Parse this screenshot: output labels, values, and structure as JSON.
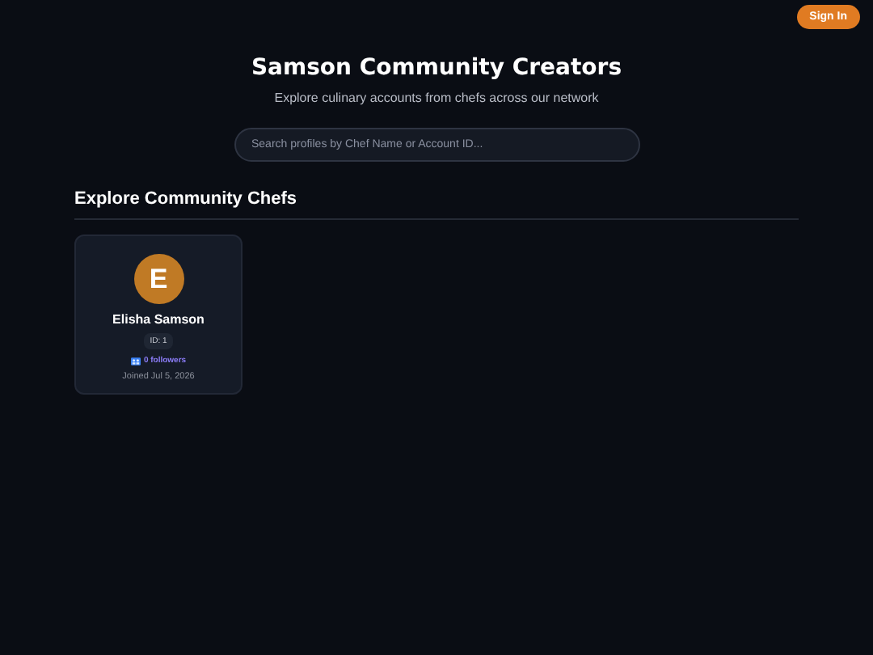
{
  "header": {
    "sign_in": "Sign In"
  },
  "hero": {
    "title": "Samson Community Creators",
    "subtitle": "Explore culinary accounts from chefs across our network"
  },
  "search": {
    "placeholder": "Search profiles by Chef Name or Account ID..."
  },
  "section": {
    "title": "Explore Community Chefs"
  },
  "chefs": [
    {
      "initial": "E",
      "name": "Elisha Samson",
      "id": "ID: 1",
      "followers": "0 followers",
      "joined": "Joined Jul 5, 2026"
    }
  ]
}
